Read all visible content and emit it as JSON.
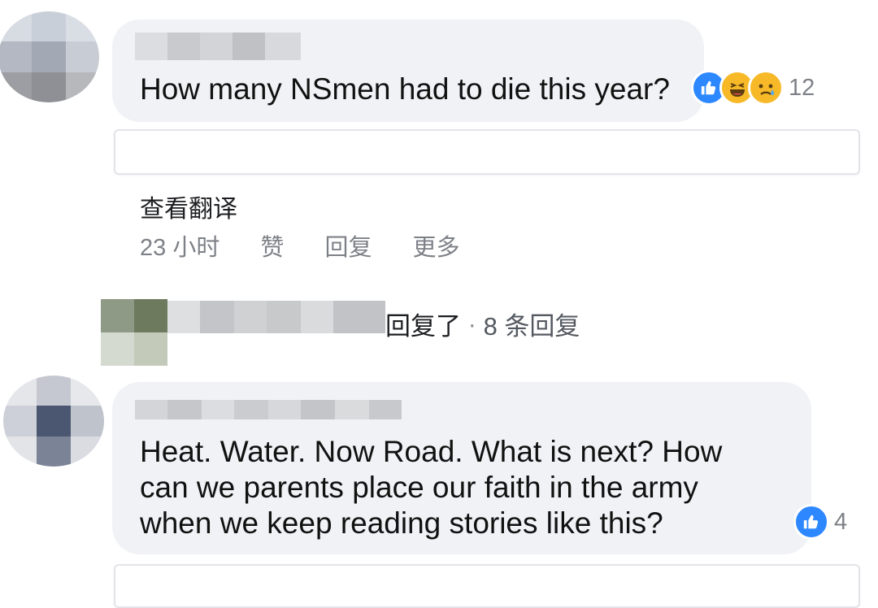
{
  "comments": [
    {
      "text": "How many NSmen had to die this year?",
      "reactions": [
        "like-icon",
        "haha-icon",
        "sad-icon"
      ],
      "reaction_count": "12",
      "translate_label": "查看翻译",
      "time": "23 小时",
      "like_label": "赞",
      "reply_label": "回复",
      "more_label": "更多",
      "replies_summary": {
        "verb": "回复了",
        "separator": " · ",
        "count_text": "8 条回复"
      }
    },
    {
      "text_lines": [
        "Heat. Water. Now Road. What is next? How",
        "can we parents place our faith in the army",
        "when we keep reading stories like this?"
      ],
      "reactions": [
        "like-icon"
      ],
      "reaction_count": "4"
    }
  ],
  "colors": {
    "bubble": "#f0f2f5",
    "like_blue": "#2d88ff",
    "emoji_yellow": "#f7b928",
    "meta_gray": "#7d8187"
  }
}
